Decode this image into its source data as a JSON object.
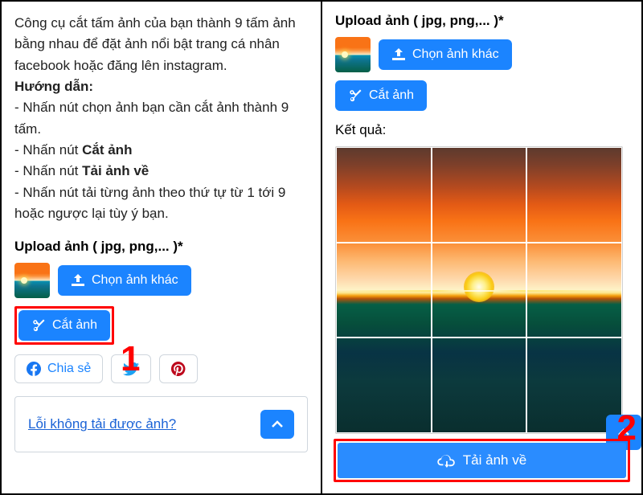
{
  "left": {
    "desc_intro": "Công cụ cắt tấm ảnh của bạn thành 9 tấm ảnh bằng nhau để đặt ảnh nổi bật trang cá nhân facebook hoặc đăng lên instagram.",
    "guide_label": "Hướng dẫn:",
    "step1": "- Nhấn nút chọn ảnh bạn cần cắt ảnh thành 9 tấm.",
    "step2a": "- Nhấn nút ",
    "step2b": "Cắt ảnh",
    "step3a": "- Nhấn nút ",
    "step3b": "Tải ảnh về",
    "step4": "- Nhấn nút tải từng ảnh theo thứ tự từ 1 tới 9 hoặc ngược lại tùy ý bạn.",
    "upload_label": "Upload ảnh ( jpg, png,... )*",
    "choose_btn": "Chọn ảnh khác",
    "cut_btn": "Cắt ảnh",
    "share_btn": "Chia sẻ",
    "error_link": "Lỗi không tải được ảnh?",
    "annot1": "1"
  },
  "right": {
    "upload_label": "Upload ảnh ( jpg, png,... )*",
    "choose_btn": "Chọn ảnh khác",
    "cut_btn": "Cắt ảnh",
    "result_label": "Kết quả:",
    "download_btn": "Tải ảnh về",
    "annot2": "2"
  }
}
